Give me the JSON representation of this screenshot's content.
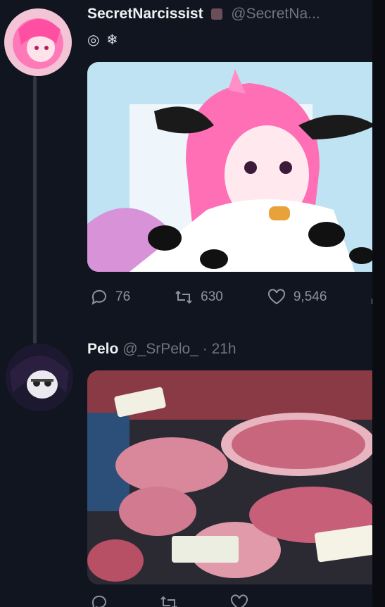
{
  "tweets": [
    {
      "author_name": "SecretNarcissist",
      "author_handle": "@SecretNa...",
      "badges": "◎ ❄",
      "actions": {
        "replies": "76",
        "retweets": "630",
        "likes": "9,546"
      }
    },
    {
      "author_name": "Pelo",
      "author_handle": "@_SrPelo_ · 21h",
      "actions": {
        "replies": "",
        "retweets": "",
        "likes": ""
      }
    }
  ],
  "colors": {
    "background": "#111520",
    "muted": "#6e767d",
    "name": "#eef0f2"
  }
}
